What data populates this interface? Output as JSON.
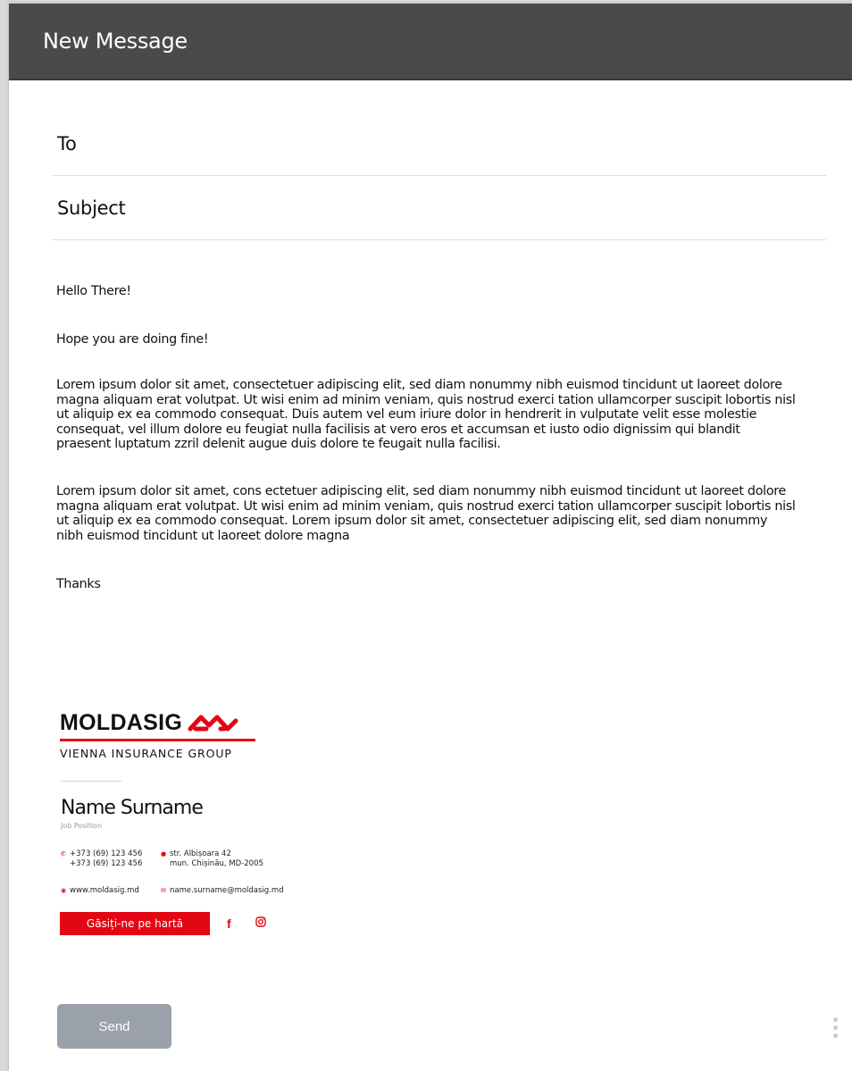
{
  "window": {
    "title": "New Message"
  },
  "fields": {
    "to_label": "To",
    "subject_label": "Subject"
  },
  "message": {
    "greeting": "Hello There!",
    "line2": "Hope you are doing fine!",
    "paragraph1": "Lorem ipsum dolor sit amet, consectetuer adipiscing elit, sed diam nonummy nibh euismod tincidunt ut laoreet dolore magna aliquam erat volutpat. Ut wisi enim ad minim veniam, quis nostrud exerci tation ullamcorper suscipit lobortis nisl ut aliquip ex ea commodo consequat. Duis autem vel eum iriure dolor in hendrerit in vulputate velit esse molestie consequat, vel illum dolore eu feugiat nulla facilisis at vero eros et accumsan et iusto odio dignissim qui blandit praesent luptatum zzril delenit augue duis dolore te feugait nulla facilisi.",
    "paragraph2": "Lorem ipsum dolor sit amet, cons ectetuer adipiscing elit, sed diam nonummy nibh euismod tincidunt ut laoreet dolore magna aliquam erat volutpat. Ut wisi enim ad minim veniam, quis nostrud exerci tation ullamcorper suscipit lobortis nisl ut aliquip ex ea commodo consequat. Lorem ipsum dolor sit amet, consectetuer adipiscing elit, sed diam nonummy nibh euismod tincidunt ut laoreet dolore magna",
    "closing": "Thanks"
  },
  "signature": {
    "logo_name": "MOLDASIG",
    "logo_sub": "VIENNA INSURANCE GROUP",
    "name": "Name Surname",
    "job": "Job Position",
    "phone1": "+373 (69) 123 456",
    "phone2": "+373 (69) 123 456",
    "address1": "str. Albișoara 42",
    "address2": "mun. Chișinău, MD-2005",
    "website": "www.moldasig.md",
    "email": "name.surname@moldasig.md",
    "map_button": "Găsiți-ne pe hartă",
    "brand_color": "#e30613"
  },
  "actions": {
    "send_label": "Send"
  },
  "icons": [
    "phone-icon",
    "location-icon",
    "globe-icon",
    "mail-icon",
    "facebook-icon",
    "instagram-icon",
    "more-vertical-icon"
  ]
}
